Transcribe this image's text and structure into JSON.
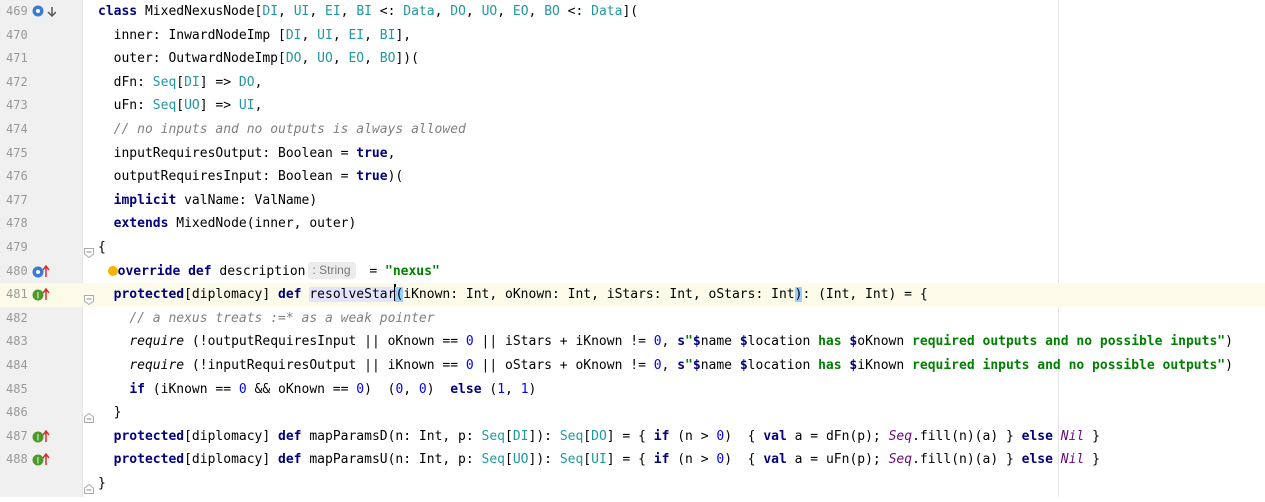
{
  "lines": [
    {
      "num": "469",
      "tokens": [
        [
          "k",
          "class "
        ],
        [
          "",
          "MixedNexusNode["
        ],
        [
          "t",
          "DI"
        ],
        [
          "",
          ", "
        ],
        [
          "t",
          "UI"
        ],
        [
          "",
          ", "
        ],
        [
          "t",
          "EI"
        ],
        [
          "",
          ", "
        ],
        [
          "t",
          "BI"
        ],
        [
          "",
          " <: "
        ],
        [
          "t",
          "Data"
        ],
        [
          "",
          ", "
        ],
        [
          "t",
          "DO"
        ],
        [
          "",
          ", "
        ],
        [
          "t",
          "UO"
        ],
        [
          "",
          ", "
        ],
        [
          "t",
          "EO"
        ],
        [
          "",
          ", "
        ],
        [
          "t",
          "BO"
        ],
        [
          "",
          " <: "
        ],
        [
          "t",
          "Data"
        ],
        [
          "",
          "]("
        ]
      ]
    },
    {
      "num": "470",
      "tokens": [
        [
          "",
          "  inner: InwardNodeImp ["
        ],
        [
          "t",
          "DI"
        ],
        [
          "",
          ", "
        ],
        [
          "t",
          "UI"
        ],
        [
          "",
          ", "
        ],
        [
          "t",
          "EI"
        ],
        [
          "",
          ", "
        ],
        [
          "t",
          "BI"
        ],
        [
          "",
          "],"
        ]
      ]
    },
    {
      "num": "471",
      "tokens": [
        [
          "",
          "  outer: OutwardNodeImp["
        ],
        [
          "t",
          "DO"
        ],
        [
          "",
          ", "
        ],
        [
          "t",
          "UO"
        ],
        [
          "",
          ", "
        ],
        [
          "t",
          "EO"
        ],
        [
          "",
          ", "
        ],
        [
          "t",
          "BO"
        ],
        [
          "",
          "])("
        ]
      ]
    },
    {
      "num": "472",
      "tokens": [
        [
          "",
          "  dFn: "
        ],
        [
          "t",
          "Seq"
        ],
        [
          "",
          "["
        ],
        [
          "t",
          "DI"
        ],
        [
          "",
          "] => "
        ],
        [
          "t",
          "DO"
        ],
        [
          "",
          ","
        ]
      ]
    },
    {
      "num": "473",
      "tokens": [
        [
          "",
          "  uFn: "
        ],
        [
          "t",
          "Seq"
        ],
        [
          "",
          "["
        ],
        [
          "t",
          "UO"
        ],
        [
          "",
          "] => "
        ],
        [
          "t",
          "UI"
        ],
        [
          "",
          ","
        ]
      ]
    },
    {
      "num": "474",
      "tokens": [
        [
          "",
          "  "
        ],
        [
          "c",
          "// no inputs and no outputs is always allowed"
        ]
      ]
    },
    {
      "num": "475",
      "tokens": [
        [
          "",
          "  inputRequiresOutput: Boolean = "
        ],
        [
          "k",
          "true"
        ],
        [
          "",
          ","
        ]
      ]
    },
    {
      "num": "476",
      "tokens": [
        [
          "",
          "  outputRequiresInput: Boolean = "
        ],
        [
          "k",
          "true"
        ],
        [
          "",
          ")("
        ]
      ]
    },
    {
      "num": "477",
      "tokens": [
        [
          "",
          "  "
        ],
        [
          "k",
          "implicit"
        ],
        [
          "",
          " valName: ValName)"
        ]
      ]
    },
    {
      "num": "478",
      "tokens": [
        [
          "",
          "  "
        ],
        [
          "k",
          "extends"
        ],
        [
          "",
          " MixedNode(inner, outer)"
        ]
      ]
    },
    {
      "num": "479",
      "tokens": [
        [
          "",
          "{"
        ]
      ]
    },
    {
      "num": "480",
      "tokens": [
        [
          "",
          "  "
        ],
        [
          "bulb",
          ""
        ],
        [
          "k",
          "override def "
        ],
        [
          "",
          "description"
        ],
        [
          "hint",
          ": String"
        ],
        [
          "",
          " = "
        ],
        [
          "s",
          "\"nexus\""
        ]
      ]
    },
    {
      "num": "481",
      "tokens": [
        [
          "",
          "  "
        ],
        [
          "k",
          "protected"
        ],
        [
          "",
          "[diplomacy] "
        ],
        [
          "k",
          "def "
        ],
        [
          "hl",
          "resolveStar"
        ],
        [
          "caret",
          ""
        ],
        [
          "br",
          "("
        ],
        [
          "",
          "iKnown: Int, oKnown: Int, iStars: Int, oStars: Int"
        ],
        [
          "br",
          ")"
        ],
        [
          "",
          ": (Int, Int) = {"
        ]
      ]
    },
    {
      "num": "482",
      "tokens": [
        [
          "",
          "    "
        ],
        [
          "c",
          "// a nexus treats :=* as a weak pointer"
        ]
      ]
    },
    {
      "num": "483",
      "tokens": [
        [
          "",
          "    "
        ],
        [
          "i",
          "require"
        ],
        [
          "",
          " (!outputRequiresInput || oKnown == "
        ],
        [
          "n",
          "0"
        ],
        [
          "",
          " || iStars + iKnown != "
        ],
        [
          "n",
          "0"
        ],
        [
          "",
          ", "
        ],
        [
          "k",
          "s"
        ],
        [
          "s",
          "\""
        ],
        [
          "k",
          "$"
        ],
        [
          "",
          "name "
        ],
        [
          "k",
          "$"
        ],
        [
          "",
          "location "
        ],
        [
          "s",
          "has "
        ],
        [
          "k",
          "$"
        ],
        [
          "",
          "oKnown "
        ],
        [
          "s",
          "required outputs and no possible inputs\""
        ],
        [
          "",
          ")"
        ]
      ]
    },
    {
      "num": "484",
      "tokens": [
        [
          "",
          "    "
        ],
        [
          "i",
          "require"
        ],
        [
          "",
          " (!inputRequiresOutput || iKnown == "
        ],
        [
          "n",
          "0"
        ],
        [
          "",
          " || oStars + oKnown != "
        ],
        [
          "n",
          "0"
        ],
        [
          "",
          ", "
        ],
        [
          "k",
          "s"
        ],
        [
          "s",
          "\""
        ],
        [
          "k",
          "$"
        ],
        [
          "",
          "name "
        ],
        [
          "k",
          "$"
        ],
        [
          "",
          "location "
        ],
        [
          "s",
          "has "
        ],
        [
          "k",
          "$"
        ],
        [
          "",
          "iKnown "
        ],
        [
          "s",
          "required inputs and no possible outputs\""
        ],
        [
          "",
          ")"
        ]
      ]
    },
    {
      "num": "485",
      "tokens": [
        [
          "",
          "    "
        ],
        [
          "k",
          "if"
        ],
        [
          "",
          " (iKnown == "
        ],
        [
          "n",
          "0"
        ],
        [
          "",
          " && oKnown == "
        ],
        [
          "n",
          "0"
        ],
        [
          "",
          ")  ("
        ],
        [
          "n",
          "0"
        ],
        [
          "",
          ", "
        ],
        [
          "n",
          "0"
        ],
        [
          "",
          ")  "
        ],
        [
          "k",
          "else"
        ],
        [
          "",
          " ("
        ],
        [
          "n",
          "1"
        ],
        [
          "",
          ", "
        ],
        [
          "n",
          "1"
        ],
        [
          "",
          ")"
        ]
      ]
    },
    {
      "num": "486",
      "tokens": [
        [
          "",
          "  }"
        ]
      ]
    },
    {
      "num": "487",
      "tokens": [
        [
          "",
          "  "
        ],
        [
          "k",
          "protected"
        ],
        [
          "",
          "[diplomacy] "
        ],
        [
          "k",
          "def "
        ],
        [
          "",
          "mapParamsD(n: Int, p: "
        ],
        [
          "t",
          "Seq"
        ],
        [
          "",
          "["
        ],
        [
          "t",
          "DI"
        ],
        [
          "",
          "]): "
        ],
        [
          "t",
          "Seq"
        ],
        [
          "",
          "["
        ],
        [
          "t",
          "DO"
        ],
        [
          "",
          "] = { "
        ],
        [
          "k",
          "if"
        ],
        [
          "",
          " (n > "
        ],
        [
          "n",
          "0"
        ],
        [
          "",
          ")  { "
        ],
        [
          "k",
          "val"
        ],
        [
          "",
          " a = dFn(p); "
        ],
        [
          "ci",
          "Seq"
        ],
        [
          "",
          ".fill(n)(a) } "
        ],
        [
          "k",
          "else "
        ],
        [
          "ci",
          "Nil"
        ],
        [
          "",
          " }"
        ]
      ]
    },
    {
      "num": "488",
      "tokens": [
        [
          "",
          "  "
        ],
        [
          "k",
          "protected"
        ],
        [
          "",
          "[diplomacy] "
        ],
        [
          "k",
          "def "
        ],
        [
          "",
          "mapParamsU(n: Int, p: "
        ],
        [
          "t",
          "Seq"
        ],
        [
          "",
          "["
        ],
        [
          "t",
          "UO"
        ],
        [
          "",
          "]): "
        ],
        [
          "t",
          "Seq"
        ],
        [
          "",
          "["
        ],
        [
          "t",
          "UI"
        ],
        [
          "",
          "] = { "
        ],
        [
          "k",
          "if"
        ],
        [
          "",
          " (n > "
        ],
        [
          "n",
          "0"
        ],
        [
          "",
          ")  { "
        ],
        [
          "k",
          "val"
        ],
        [
          "",
          " a = uFn(p); "
        ],
        [
          "ci",
          "Seq"
        ],
        [
          "",
          ".fill(n)(a) } "
        ],
        [
          "k",
          "else "
        ],
        [
          "ci",
          "Nil"
        ],
        [
          "",
          " }"
        ]
      ]
    },
    {
      "num": "",
      "tokens": [
        [
          "",
          "}"
        ]
      ]
    }
  ]
}
